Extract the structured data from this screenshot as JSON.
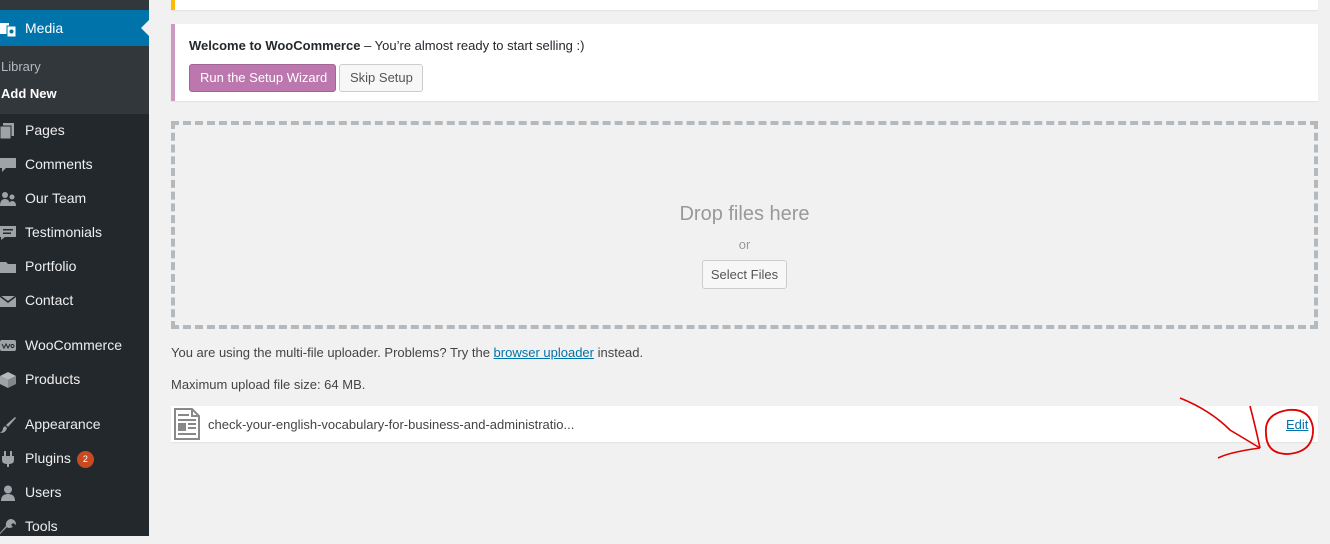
{
  "sidebar": {
    "media_label": "Media",
    "submenu": {
      "library": "Library",
      "add_new": "Add New"
    },
    "items": [
      {
        "label": "Pages",
        "icon": "pages-icon"
      },
      {
        "label": "Comments",
        "icon": "comments-icon"
      },
      {
        "label": "Our Team",
        "icon": "users-icon"
      },
      {
        "label": "Testimonials",
        "icon": "testimonials-icon"
      },
      {
        "label": "Portfolio",
        "icon": "folder-icon"
      },
      {
        "label": "Contact",
        "icon": "envelope-icon"
      },
      {
        "label": "WooCommerce",
        "icon": "woo-icon"
      },
      {
        "label": "Products",
        "icon": "box-icon"
      },
      {
        "label": "Appearance",
        "icon": "brush-icon"
      },
      {
        "label": "Plugins",
        "icon": "plugin-icon",
        "badge": "2"
      },
      {
        "label": "Users",
        "icon": "user-icon"
      },
      {
        "label": "Tools",
        "icon": "wrench-icon"
      }
    ]
  },
  "woo_notice": {
    "title": "Welcome to WooCommerce",
    "message": " – You’re almost ready to start selling :)",
    "wizard_button": "Run the Setup Wizard",
    "skip_button": "Skip Setup"
  },
  "dropzone": {
    "title": "Drop files here",
    "or": "or",
    "select_button": "Select Files"
  },
  "uploader": {
    "info_prefix": "You are using the multi-file uploader. Problems? Try the ",
    "info_link": "browser uploader",
    "info_suffix": " instead.",
    "max_size": "Maximum upload file size: 64 MB."
  },
  "media_item": {
    "filename": "check-your-english-vocabulary-for-business-and-administratio...",
    "edit_link": "Edit"
  },
  "colors": {
    "sidebar_bg": "#23282d",
    "active_menu": "#0073aa",
    "woo_button": "#bb77ae",
    "annotation": "#e00000"
  }
}
